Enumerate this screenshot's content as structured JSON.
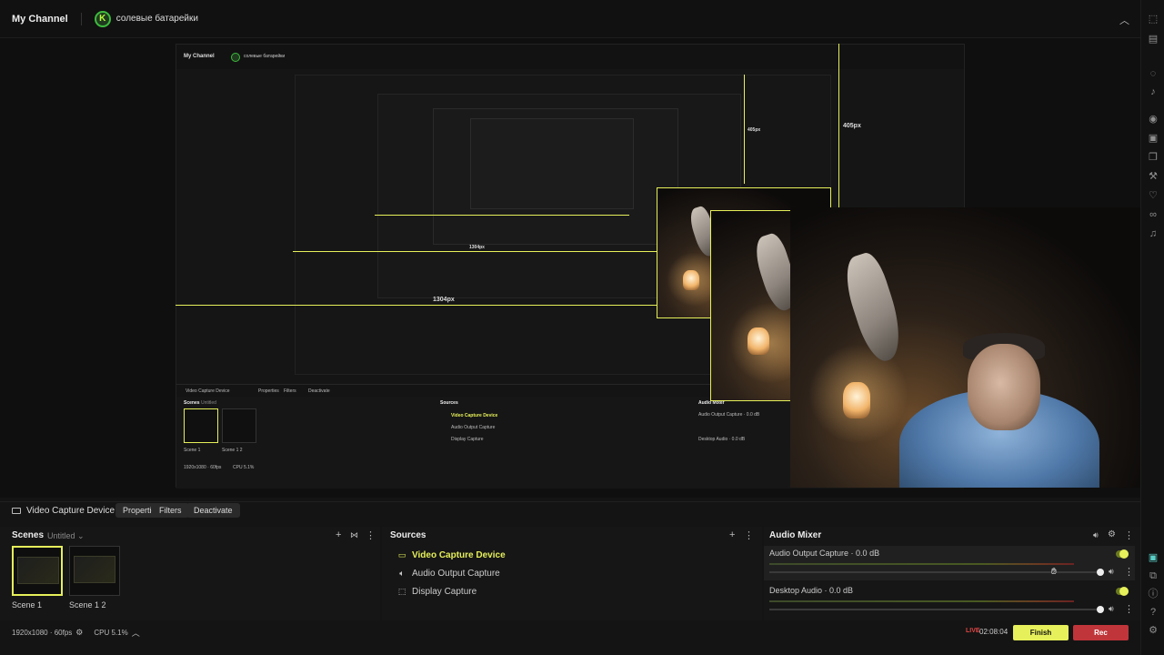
{
  "app": {
    "channel_title": "My Channel",
    "account_initial": "K",
    "account_name": "солевые батарейки"
  },
  "preview": {
    "measure_labels": [
      "405px",
      "1304px",
      "1304px",
      "405px"
    ],
    "accent_color": "#e6f05a",
    "nested": {
      "channel_title": "My Channel",
      "account_name": "солевые батарейки",
      "source_name": "Video Capture Device",
      "properties": "Properties",
      "filters": "Filters",
      "deactivate": "Deactivate",
      "scenes": "Scenes",
      "untitled": "Untitled",
      "sources": "Sources",
      "audio_mixer": "Audio Mixer",
      "src_items": [
        "Video Capture Device",
        "Audio Output Capture",
        "Display Capture"
      ],
      "mix_items": [
        "Audio Output Capture · 0.0 dB",
        "Desktop Audio · 0.0 dB"
      ],
      "scene_labels": [
        "Scene 1",
        "Scene 1 2"
      ],
      "res": "1920x1080 · 60fps",
      "cpu": "CPU 5.1%"
    }
  },
  "source_toolbar": {
    "source_name": "Video Capture Device",
    "properties": "Properties",
    "filters": "Filters",
    "deactivate": "Deactivate"
  },
  "scenes": {
    "title": "Scenes",
    "collection": "Untitled",
    "items": [
      {
        "label": "Scene 1",
        "active": true
      },
      {
        "label": "Scene 1 2",
        "active": false
      }
    ]
  },
  "sources": {
    "title": "Sources",
    "items": [
      {
        "label": "Video Capture Device",
        "icon": "camera-icon",
        "active": true
      },
      {
        "label": "Audio Output Capture",
        "icon": "speaker-icon",
        "active": false
      },
      {
        "label": "Display Capture",
        "icon": "display-icon",
        "active": false
      }
    ]
  },
  "audio_mixer": {
    "title": "Audio Mixer",
    "channels": [
      {
        "label": "Audio Output Capture · 0.0 dB",
        "volume": 0.95,
        "enabled": true
      },
      {
        "label": "Desktop Audio · 0.0 dB",
        "volume": 0.95,
        "enabled": true
      }
    ]
  },
  "status": {
    "resolution": "1920x1080 · 60fps",
    "cpu": "CPU 5.1%",
    "live_label": "LIVE",
    "timer": "02:08:04",
    "finish": "Finish",
    "rec": "Rec",
    "accent_color": "#e6f05a",
    "rec_color": "#c0353a"
  },
  "rail_icons": [
    "dock-icon",
    "layout-icon",
    "chat-icon",
    "bell-icon",
    "camera-icon",
    "screenshot-icon",
    "copy-icon",
    "tools-icon",
    "heart-icon",
    "link-icon",
    "music-icon",
    "app-icon",
    "plugin-icon",
    "info-icon",
    "help-icon",
    "settings-icon"
  ]
}
